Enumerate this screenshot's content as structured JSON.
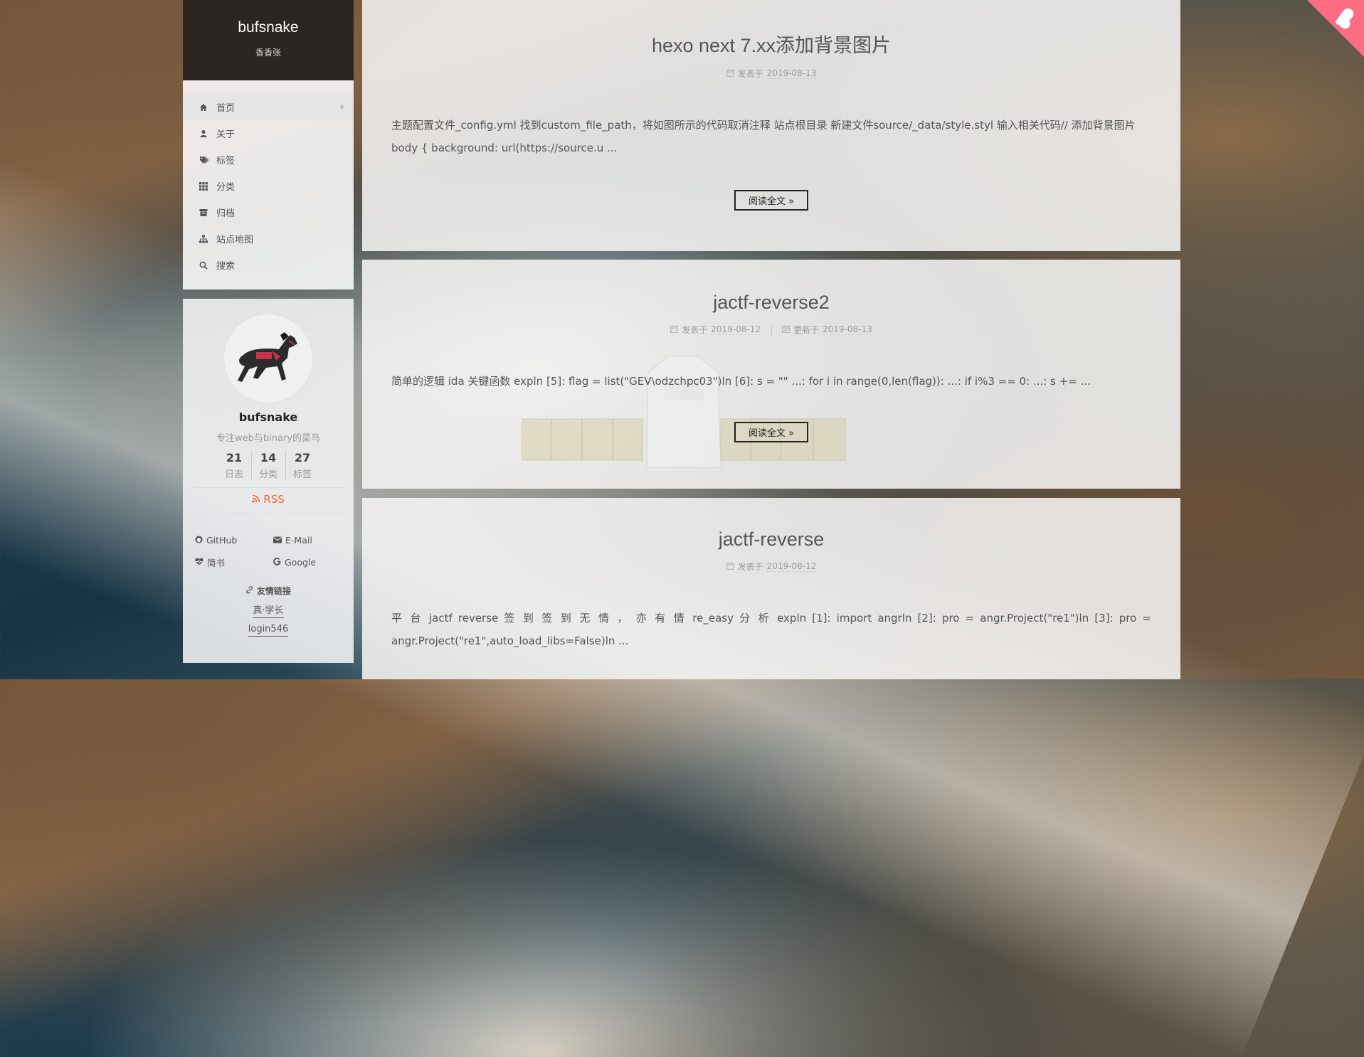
{
  "site": {
    "title": "bufsnake",
    "subtitle": "香香张"
  },
  "menu": [
    {
      "label": "首页",
      "icon": "home-icon",
      "active": true
    },
    {
      "label": "关于",
      "icon": "user-icon"
    },
    {
      "label": "标签",
      "icon": "tags-icon"
    },
    {
      "label": "分类",
      "icon": "th-icon"
    },
    {
      "label": "归档",
      "icon": "archive-icon"
    },
    {
      "label": "站点地图",
      "icon": "sitemap-icon"
    },
    {
      "label": "搜索",
      "icon": "search-icon"
    }
  ],
  "author": {
    "name": "bufsnake",
    "description": "专注web与binary的菜鸟",
    "stats": [
      {
        "count": "21",
        "label": "日志"
      },
      {
        "count": "14",
        "label": "分类"
      },
      {
        "count": "27",
        "label": "标签"
      }
    ],
    "rss": "RSS",
    "social": [
      {
        "label": "GitHub",
        "icon": "github-icon"
      },
      {
        "label": "E-Mail",
        "icon": "envelope-icon"
      },
      {
        "label": "简书",
        "icon": "heartbeat-icon"
      },
      {
        "label": "Google",
        "icon": "google-icon"
      }
    ],
    "blogroll_title": "友情链接",
    "blogroll": [
      "真·学长",
      "login546"
    ]
  },
  "posts": [
    {
      "title": "hexo next 7.xx添加背景图片",
      "posted_label": "发表于",
      "posted": "2019-08-13",
      "excerpt": "主题配置文件_config.yml 找到custom_file_path，将如图所示的代码取消注释 站点根目录 新建文件source/_data/style.styl 输入相关代码// 添加背景图片body { background: url(https://source.u ...",
      "read_more": "阅读全文 »"
    },
    {
      "title": "jactf-reverse2",
      "posted_label": "发表于",
      "posted": "2019-08-12",
      "updated_label": "更新于",
      "updated": "2019-08-13",
      "excerpt": "简单的逻辑 ida 关键函数 expln [5]: flag = list(\"GEV\\odzchpc03\")ln [6]: s = \"\" ...: for i in range(0,len(flag)): ...: if i%3 == 0: ...: s += ...",
      "read_more": "阅读全文 »"
    },
    {
      "title": "jactf-reverse",
      "posted_label": "发表于",
      "posted": "2019-08-12",
      "excerpt": "平 台 jactf  reverse 签 到   签 到 无 情 ， 亦 有 情   re_easy  分 析   expln  [1]:  import  angrln  [2]:  pro  =  angr.Project(\"re1\")ln  [3]:  pro  =  angr.Project(\"re1\",auto_load_libs=False)ln ..."
    }
  ],
  "colors": {
    "accent": "#fc6423",
    "brand_bg": "#2a2622",
    "ribbon": "#fc6d83"
  }
}
